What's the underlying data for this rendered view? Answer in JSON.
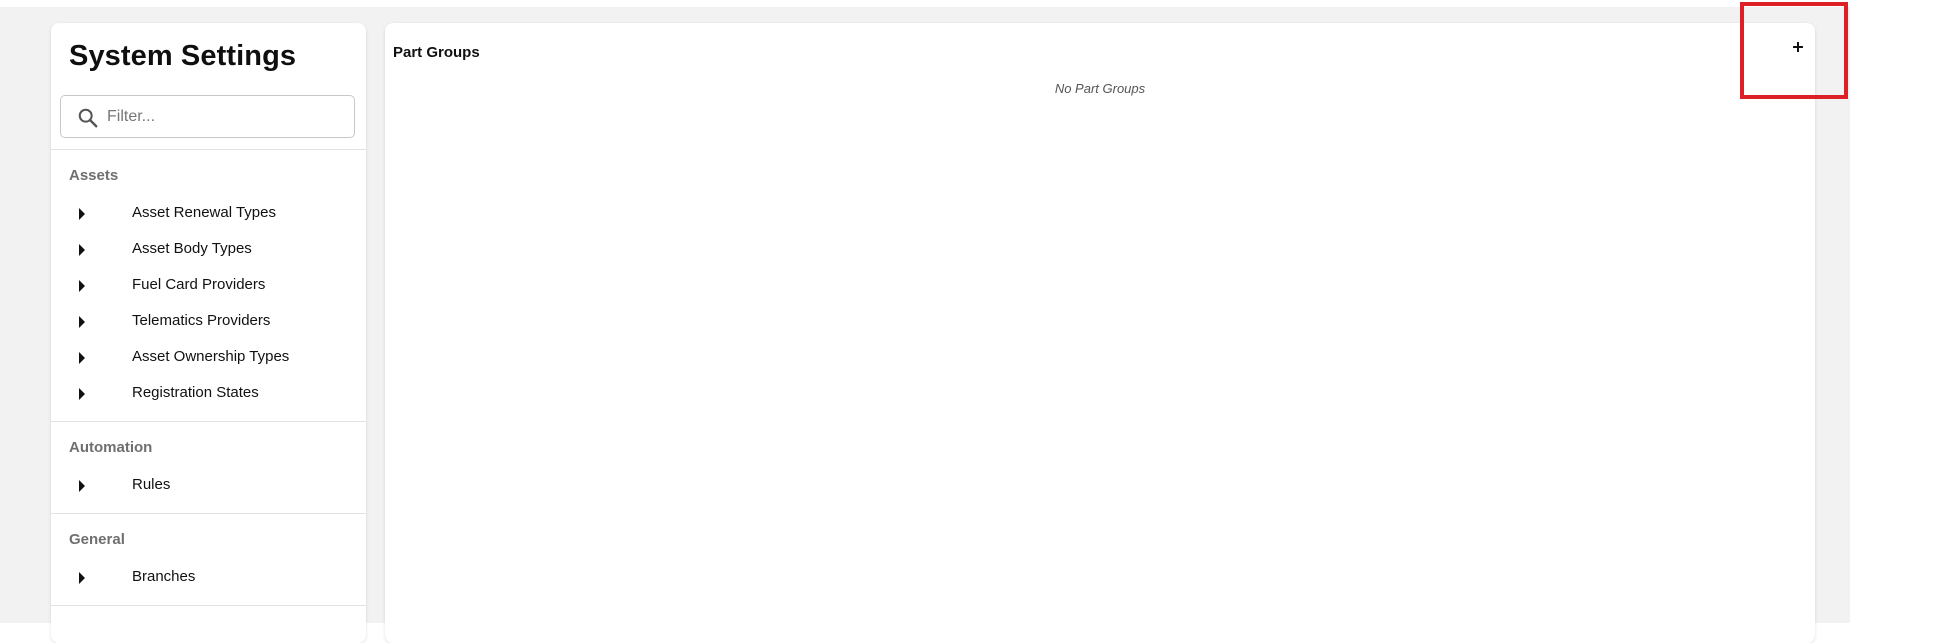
{
  "sidebar": {
    "title": "System Settings",
    "filter_placeholder": "Filter...",
    "sections": [
      {
        "heading": "Assets",
        "items": [
          "Asset Renewal Types",
          "Asset Body Types",
          "Fuel Card Providers",
          "Telematics Providers",
          "Asset Ownership Types",
          "Registration States"
        ]
      },
      {
        "heading": "Automation",
        "items": [
          "Rules"
        ]
      },
      {
        "heading": "General",
        "items": [
          "Branches"
        ]
      }
    ]
  },
  "main": {
    "title": "Part Groups",
    "add_label": "+",
    "empty_message": "No Part Groups"
  },
  "colors": {
    "page_background": "#f2f2f2",
    "panel_background": "#ffffff",
    "section_heading": "#6f6f6f",
    "highlight": "#dd1f26"
  },
  "icons": {
    "filter": "search-icon",
    "nav_expand": "caret-right-icon",
    "add": "plus-icon"
  }
}
